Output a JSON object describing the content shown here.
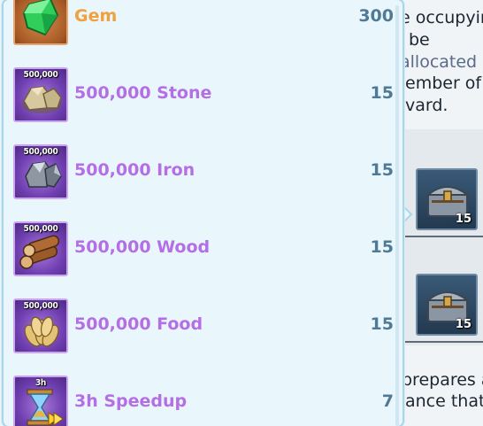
{
  "background": {
    "lines": [
      "e occupyin",
      "be",
      "allocated",
      "ember of",
      "vard.",
      "prepares a",
      "ance that"
    ]
  },
  "chests": [
    {
      "count": "15",
      "icon": "chest-icon"
    },
    {
      "count": "15",
      "icon": "chest-icon"
    }
  ],
  "rewards": [
    {
      "name": "Gem",
      "qty": "300",
      "icon": "gem-icon",
      "tag": ""
    },
    {
      "name": "500,000 Stone",
      "qty": "15",
      "icon": "stone-icon",
      "tag": "500,000"
    },
    {
      "name": "500,000 Iron",
      "qty": "15",
      "icon": "iron-icon",
      "tag": "500,000"
    },
    {
      "name": "500,000 Wood",
      "qty": "15",
      "icon": "wood-icon",
      "tag": "500,000"
    },
    {
      "name": "500,000 Food",
      "qty": "15",
      "icon": "food-icon",
      "tag": "500,000"
    },
    {
      "name": "3h Speedup",
      "qty": "7",
      "icon": "hourglass-icon",
      "tag": "3h"
    }
  ],
  "colors": {
    "rare_name": "#b46ee6",
    "gem_name": "#f0a03c",
    "quantity": "#4f7a95",
    "panel_bg": "#e9f7fc"
  }
}
